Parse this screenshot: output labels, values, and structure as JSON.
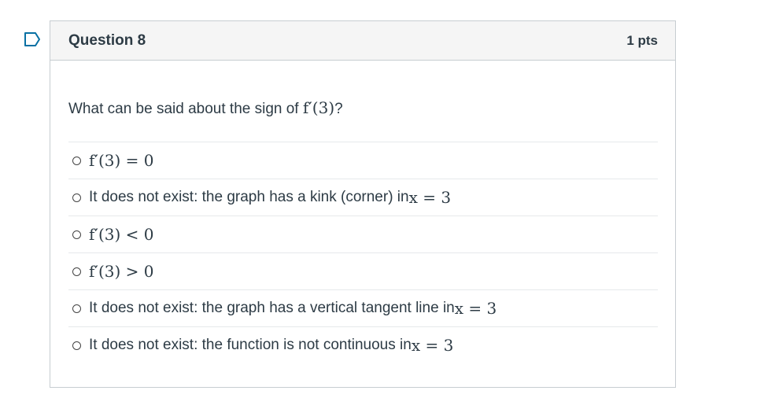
{
  "question": {
    "title": "Question 8",
    "points": "1 pts",
    "flag_icon": "flag-bookmark-icon",
    "prompt_text": "What can be said about the sign of ",
    "prompt_math": "f′(3)",
    "prompt_suffix": "?"
  },
  "answers": [
    {
      "text": "",
      "math": "f′(3) = 0"
    },
    {
      "text": "It does not exist: the graph has a kink (corner) in ",
      "math": "x = 3"
    },
    {
      "text": "",
      "math": "f′(3) < 0"
    },
    {
      "text": "",
      "math": "f′(3) > 0"
    },
    {
      "text": "It does not exist: the graph has a vertical tangent line in ",
      "math": "x = 3"
    },
    {
      "text": "It does not exist: the function is not continuous in ",
      "math": "x = 3"
    }
  ],
  "colors": {
    "accent": "#0770a3",
    "header_bg": "#f5f5f5",
    "border": "#c7cdd1",
    "text": "#2d3b45"
  }
}
